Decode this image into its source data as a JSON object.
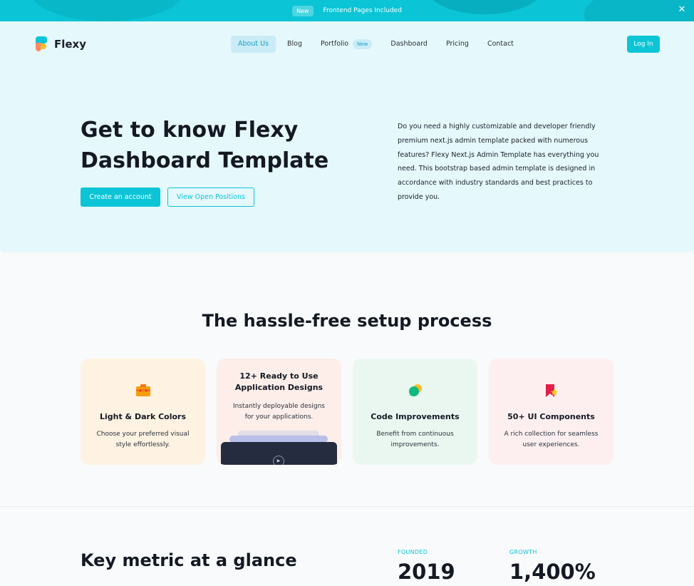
{
  "banner": {
    "badge": "New",
    "text": "Frontend Pages Included",
    "close_icon": "close-icon"
  },
  "nav": {
    "logo_text": "Flexy",
    "items": [
      {
        "label": "About Us"
      },
      {
        "label": "Blog"
      },
      {
        "label": "Portfolio",
        "badge": "New"
      },
      {
        "label": "Dashboard"
      },
      {
        "label": "Pricing"
      },
      {
        "label": "Contact"
      }
    ],
    "login_label": "Log In"
  },
  "hero": {
    "title_line1": "Get to know Flexy",
    "title_line2": "Dashboard Template",
    "primary_button": "Create an account",
    "secondary_button": "View Open Positions",
    "description": "Do you need a highly customizable and developer friendly premium next.js admin template packed with numerous features? Flexy Next.js Admin Template has everything you need. This bootstrap based admin template is designed in accordance with industry standards and best practices to provide you."
  },
  "setup": {
    "title": "The hassle-free setup process",
    "cards": [
      {
        "title": "Light & Dark Colors",
        "desc": "Choose your preferred visual style effortlessly.",
        "icon": "palette-icon"
      },
      {
        "title": "12+ Ready to Use Application Designs",
        "desc": "Instantly deployable designs for your applications.",
        "icon": "play-icon"
      },
      {
        "title": "Code Improvements",
        "desc": "Benefit from continuous improvements.",
        "icon": "chat-icon"
      },
      {
        "title": "50+ UI Components",
        "desc": "A rich collection for seamless user experiences.",
        "icon": "bookmark-star-icon"
      }
    ]
  },
  "metrics": {
    "title": "Key metric at a glance",
    "items": [
      {
        "label": "FOUNDED",
        "value": "2019"
      },
      {
        "label": "GROWTH",
        "value": "1,400%"
      }
    ]
  },
  "colors": {
    "accent": "#0bc5d6",
    "hero_bg": "#e5f8fc"
  }
}
